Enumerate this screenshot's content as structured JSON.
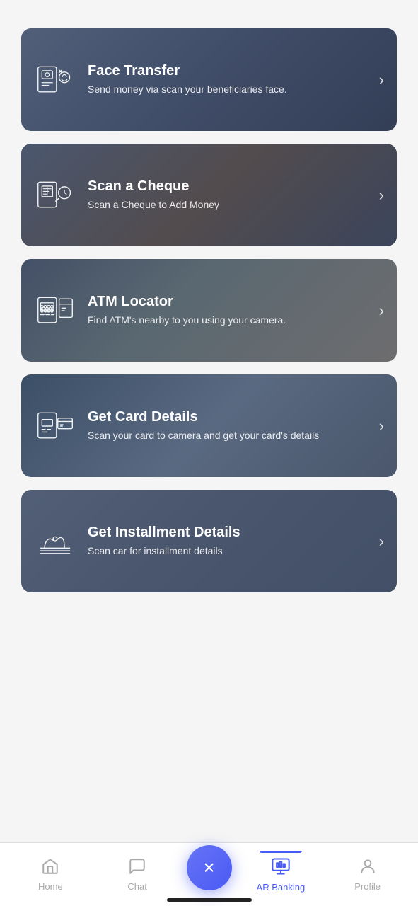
{
  "cards": [
    {
      "id": "face-transfer",
      "title": "Face Transfer",
      "subtitle": "Send money via scan your beneficiaries face.",
      "icon": "face-transfer-icon",
      "bgClass": "card-bg-1"
    },
    {
      "id": "scan-cheque",
      "title": "Scan a Cheque",
      "subtitle": "Scan a Cheque to Add Money",
      "icon": "scan-cheque-icon",
      "bgClass": "card-bg-2"
    },
    {
      "id": "atm-locator",
      "title": "ATM Locator",
      "subtitle": "Find ATM's nearby to you using your camera.",
      "icon": "atm-locator-icon",
      "bgClass": "card-bg-3"
    },
    {
      "id": "get-card-details",
      "title": "Get Card Details",
      "subtitle": "Scan your card to camera and get your card's details",
      "icon": "card-details-icon",
      "bgClass": "card-bg-4"
    },
    {
      "id": "get-installment-details",
      "title": "Get Installment Details",
      "subtitle": "Scan car for installment details",
      "icon": "installment-icon",
      "bgClass": "card-bg-5"
    }
  ],
  "nav": {
    "items": [
      {
        "id": "home",
        "label": "Home",
        "active": false
      },
      {
        "id": "chat",
        "label": "Chat",
        "active": false
      },
      {
        "id": "center",
        "label": "",
        "active": false
      },
      {
        "id": "ar-banking",
        "label": "AR Banking",
        "active": true
      },
      {
        "id": "profile",
        "label": "Profile",
        "active": false
      }
    ],
    "close_icon": "×"
  }
}
